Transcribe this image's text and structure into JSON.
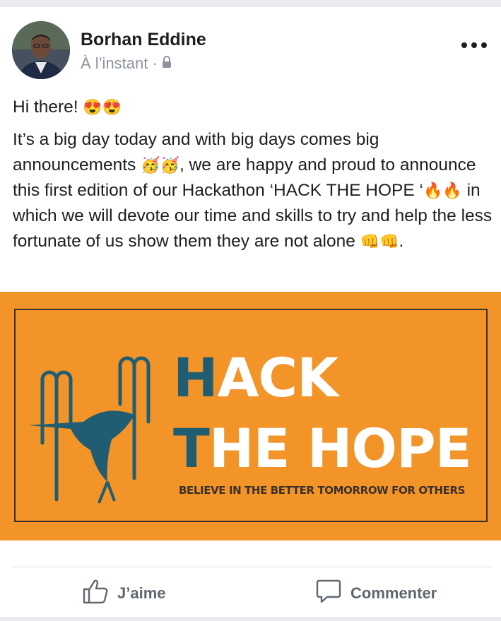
{
  "post": {
    "author": "Borhan Eddine",
    "timestamp": "À l’instant",
    "separator": "·",
    "privacy_icon": "lock-icon",
    "menu_icon": "more-options-icon",
    "greeting": "Hi there!",
    "greeting_emojis": "😍😍",
    "body_part1": "It’s a big day today and with big days comes big announcements ",
    "emoji_party": "🥳🥳",
    "body_part2": ", we are happy and proud to announce this first edition of our Hackathon ‘HACK THE HOPE ‘",
    "emoji_fire": "🔥🔥",
    "body_part3": " in which we will devote our time and skills to try and help the less fortunate of us show them they are not alone ",
    "emoji_fist": "👊👊",
    "body_end": "."
  },
  "banner": {
    "line1_highlight": "H",
    "line1_rest": "ACK",
    "line2_highlight": "T",
    "line2_rest": "HE HOPE",
    "tagline": "BELIEVE IN THE BETTER TOMORROW FOR OTHERS",
    "background_color": "#f29428",
    "accent_color": "#205d73"
  },
  "actions": {
    "like_label": "J’aime",
    "like_icon": "thumbs-up-icon",
    "comment_label": "Commenter",
    "comment_icon": "comment-bubble-icon"
  }
}
